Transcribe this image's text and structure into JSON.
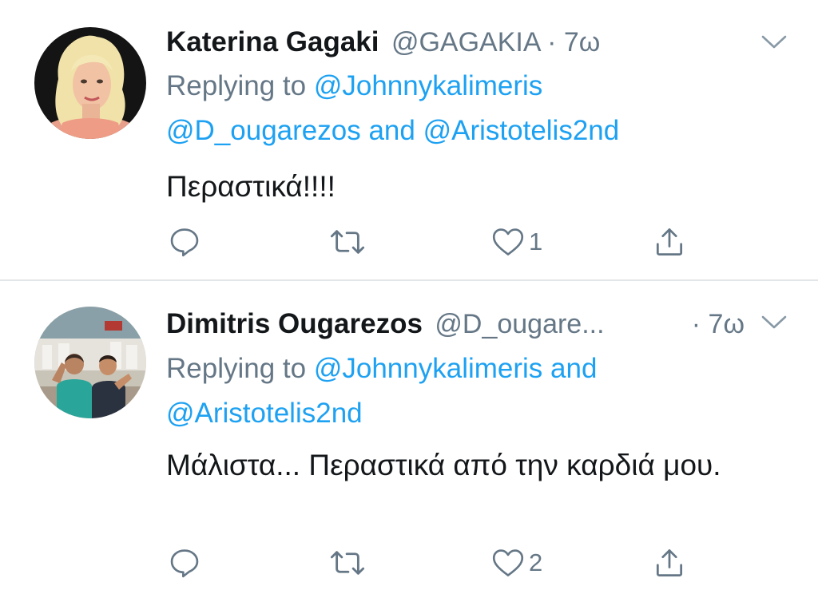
{
  "tweets": [
    {
      "name": "Katerina Gagaki",
      "handle": "@GAGAKIA",
      "separator": "·",
      "time": "7ω",
      "replying_prefix": "Replying to",
      "mention_1": "@Johnnykalimeris",
      "mention_2": "@D_ougarezos",
      "conjunction": "and",
      "mention_3": "@Aristotelis2nd",
      "text": "Περαστικά!!!!",
      "like_count": "1"
    },
    {
      "name": "Dimitris Ougarezos",
      "handle": "@D_ougare...",
      "separator": "·",
      "time": "7ω",
      "replying_prefix": "Replying to",
      "mention_1": "@Johnnykalimeris",
      "conjunction": "and",
      "mention_2": "@Aristotelis2nd",
      "text": "Μάλιστα... Περαστικά από την καρδιά μου.",
      "like_count": "2"
    }
  ],
  "icons": {
    "reply": "reply-icon",
    "retweet": "retweet-icon",
    "like": "heart-icon",
    "share": "share-icon",
    "more": "chevron-down-icon"
  },
  "colors": {
    "name": "#14171a",
    "secondary": "#657786",
    "link": "#1da1f2",
    "divider": "#e3e6e8"
  }
}
